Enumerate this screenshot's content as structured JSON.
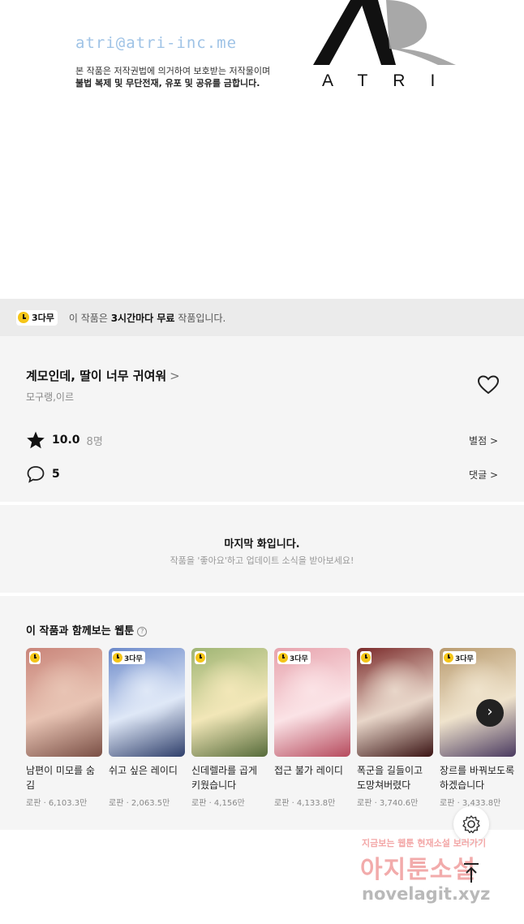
{
  "banner": {
    "email": "atri@atri-inc.me",
    "copyright_line1": "본 작품은 저작권법에 의거하여 보호받는 저작물이며",
    "copyright_line2": "불법 복제 및 무단전재, 유포 및 공유를 금합니다.",
    "logo_text": "ATRI"
  },
  "free_notice": {
    "badge": "3다무",
    "text_prefix": "이 작품은 ",
    "text_bold": "3시간마다 무료",
    "text_suffix": " 작품입니다."
  },
  "work": {
    "title": "계모인데, 딸이 너무 귀여워",
    "title_chevron": ">",
    "authors": "모구랭,이르",
    "rating": "10.0",
    "rating_count": "8명",
    "rating_link": "별점 >",
    "comment_count": "5",
    "comment_link": "댓글 >"
  },
  "last_episode": {
    "title": "마지막 화입니다.",
    "subtitle": "작품을 '좋아요'하고 업데이트 소식을 받아보세요!"
  },
  "recommendations": {
    "heading": "이 작품과 함께보는 웹툰",
    "help": "?",
    "next": "›",
    "items": [
      {
        "title": "남편이 미모를 숨김",
        "meta": "로판 · 6,103.3만",
        "badge": "",
        "colors": [
          "#c9857a",
          "#e8c4b4",
          "#7a4f45"
        ]
      },
      {
        "title": "쉬고 싶은 레이디",
        "meta": "로판 · 2,063.5만",
        "badge": "3다무",
        "colors": [
          "#6a88c9",
          "#dfe8f7",
          "#2f3f6b"
        ]
      },
      {
        "title": "신데렐라를 곱게 키웠습니다",
        "meta": "로판 · 4,156만",
        "badge": "",
        "colors": [
          "#9fb574",
          "#f2e7b8",
          "#566b3a"
        ]
      },
      {
        "title": "접근 불가 레이디",
        "meta": "로판 · 4,133.8만",
        "badge": "3다무",
        "colors": [
          "#e7a3ad",
          "#fbe3e6",
          "#b64a5d"
        ]
      },
      {
        "title": "폭군을 길들이고 도망쳐버렸다",
        "meta": "로판 · 3,740.6만",
        "badge": "",
        "colors": [
          "#7a2a2a",
          "#e8d6c9",
          "#3b1414"
        ]
      },
      {
        "title": "장르를 바꿔보도록 하겠습니다",
        "meta": "로판 · 3,433.8만",
        "badge": "3다무",
        "colors": [
          "#b89a6e",
          "#efe3cc",
          "#4a3a60"
        ]
      }
    ]
  },
  "watermark": {
    "line1": "지금보는 웹툰 현재소설 보러가기",
    "line2": "아지툰소설",
    "line3": "novelagit.xyz"
  }
}
